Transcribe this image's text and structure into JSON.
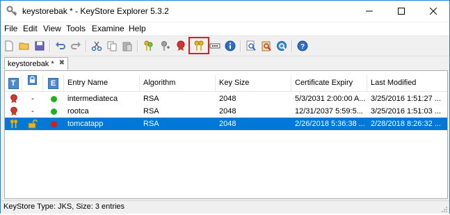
{
  "window": {
    "title": "keystorebak * - KeyStore Explorer 5.3.2"
  },
  "menu": [
    "File",
    "Edit",
    "View",
    "Tools",
    "Examine",
    "Help"
  ],
  "toolbar_icons": [
    "new-icon",
    "open-icon",
    "save-icon",
    "undo-icon",
    "redo-icon",
    "cut-icon",
    "copy-icon",
    "paste-icon",
    "generate-key-pair-icon",
    "generate-secret-key-icon",
    "import-trusted-certificate-icon",
    "import-key-pair-icon",
    "set-password-icon",
    "properties-icon",
    "examine-file-icon",
    "examine-clipboard-icon",
    "examine-ssl-icon",
    "help-icon"
  ],
  "tab": {
    "label": "keystorebak *",
    "close": "✖"
  },
  "table": {
    "header_icons": [
      "T",
      "lock",
      "E"
    ],
    "columns": [
      "Entry Name",
      "Algorithm",
      "Key Size",
      "Certificate Expiry",
      "Last Modified"
    ],
    "rows": [
      {
        "type": "certificate",
        "lock": "-",
        "expiry_status": "green",
        "name": "intermediateca",
        "algorithm": "RSA",
        "key_size": "2048",
        "expiry": "5/3/2031 2:00:00 A...",
        "modified": "3/25/2016 1:51:27 ...",
        "selected": false
      },
      {
        "type": "certificate",
        "lock": "-",
        "expiry_status": "green",
        "name": "rootca",
        "algorithm": "RSA",
        "key_size": "2048",
        "expiry": "12/31/2037 5:59:5...",
        "modified": "3/25/2016 1:51:03 ...",
        "selected": false
      },
      {
        "type": "key-pair",
        "lock": "unlocked",
        "expiry_status": "red",
        "name": "tomcatapp",
        "algorithm": "RSA",
        "key_size": "2048",
        "expiry": "2/26/2018 5:36:38 ...",
        "modified": "2/28/2018 8:26:32 ...",
        "selected": true
      }
    ]
  },
  "status": "KeyStore Type: JKS, Size: 3 entries",
  "colors": {
    "selection": "#0078d7",
    "highlight_box": "#e31b1b",
    "expiry_ok": "#1bb21b",
    "expiry_bad": "#d81b1b"
  }
}
